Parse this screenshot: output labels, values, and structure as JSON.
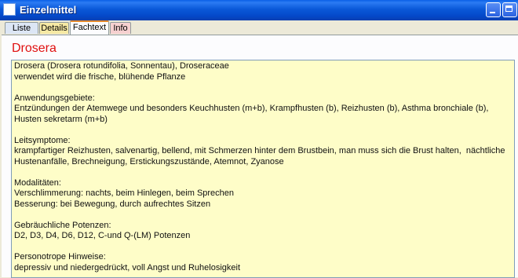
{
  "window": {
    "title": "Einzelmittel"
  },
  "tabs": [
    {
      "label": "Liste"
    },
    {
      "label": "Details"
    },
    {
      "label": "Fachtext"
    },
    {
      "label": "Info"
    }
  ],
  "content": {
    "heading": "Drosera",
    "text": "Drosera (Drosera rotundifolia, Sonnentau), Droseraceae\nverwendet wird die frische, blühende Pflanze\n\nAnwendungsgebiete:\nEntzündungen der Atemwege und besonders Keuchhusten (m+b), Krampfhusten (b), Reizhusten (b), Asthma bronchiale (b),\nHusten sekretarm (m+b)\n\nLeitsymptome:\nkrampfartiger Reizhusten, salvenartig, bellend, mit Schmerzen hinter dem Brustbein, man muss sich die Brust halten,  nächtliche\nHustenanfälle, Brechneigung, Erstickungszustände, Atemnot, Zyanose\n\nModalitäten:\nVerschlimmerung: nachts, beim Hinlegen, beim Sprechen\nBesserung: bei Bewegung, durch aufrechtes Sitzen\n\nGebräuchliche Potenzen:\nD2, D3, D4, D6, D12, C-und Q-(LM) Potenzen\n\nPersonotrope Hinweise:\ndepressiv und niedergedrückt, voll Angst und Ruhelosigkeit"
  }
}
